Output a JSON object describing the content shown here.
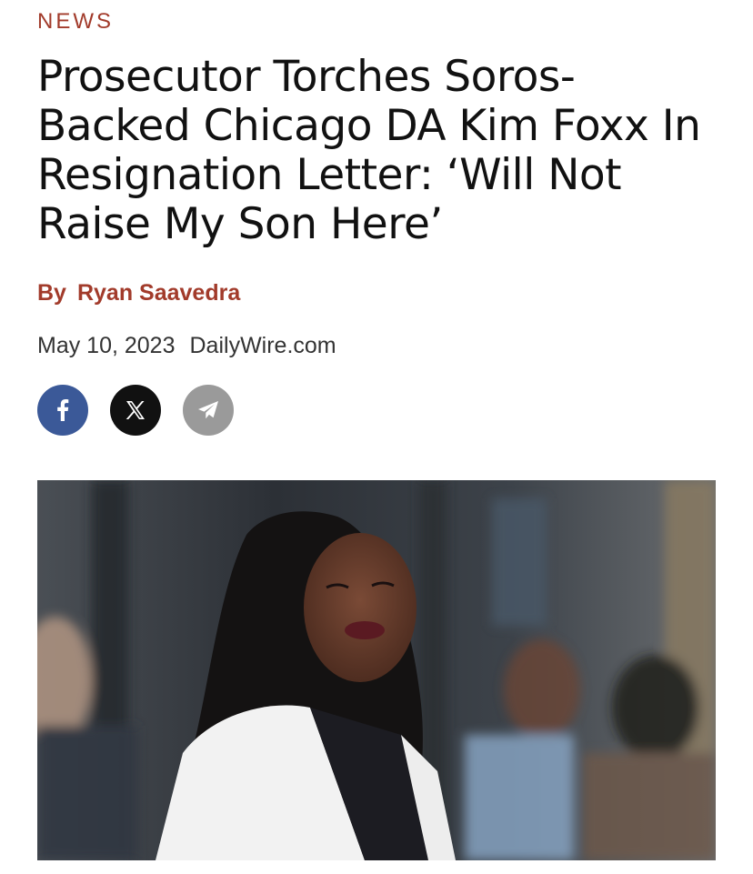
{
  "article": {
    "category": "NEWS",
    "headline": "Prosecutor Torches Soros-Backed Chicago DA Kim Foxx In Resignation Letter: ‘Will Not Raise My Son Here’",
    "byline_prefix": "By",
    "author": "Ryan Saavedra",
    "date": "May 10, 2023",
    "source": "DailyWire.com"
  },
  "share": [
    {
      "network": "facebook",
      "icon": "facebook-icon",
      "color": "#3b5998"
    },
    {
      "network": "x",
      "icon": "x-icon",
      "color": "#111111"
    },
    {
      "network": "email",
      "icon": "paper-plane-icon",
      "color": "#9a9a9a"
    }
  ],
  "colors": {
    "accent": "#a23b2b",
    "text": "#111111",
    "meta_text": "#333333"
  }
}
